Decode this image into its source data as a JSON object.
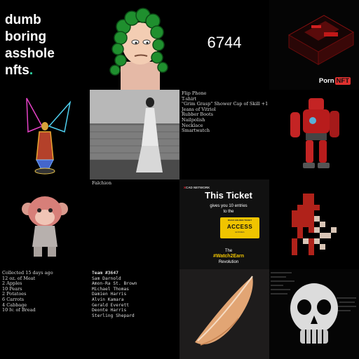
{
  "brand": {
    "line1": "dumb",
    "line2": "boring",
    "line3": "asshole",
    "line4": "nfts",
    "dot": "."
  },
  "big_number": "6744",
  "porn_tile": {
    "word": "Porn",
    "badge": "NFT",
    "accent": "#e0312f"
  },
  "inventory": [
    "Flip Phone",
    "T-shirt",
    "\"Grim Grasp\" Shower Cap of Skill +1",
    "Jeans of Vitriol",
    "Rubber Boots",
    "Nailpolish",
    "Necklace",
    "Smartwatch"
  ],
  "weapon": "Falchion",
  "ticket": {
    "network": "CAD NETWORK",
    "network_prefix": "X",
    "title": "This Ticket",
    "line1": "gives you 10 entries",
    "line2": "to the",
    "card_top": "ROAD GOLDEN TICKET",
    "card_main": "ACCESS",
    "card_bottom": "ENTRIES",
    "foot1": "The",
    "foot2": "#Watch2Earn",
    "foot3": "Revolution"
  },
  "loot": {
    "header": "Collected 15 days ago",
    "items": [
      "12 oz. of Meat",
      "2 Apples",
      "10 Pears",
      "2 Potatoes",
      "6 Carrots",
      "4 Cabbage",
      "10 lv. of Bread"
    ]
  },
  "team": {
    "header": "Team #3647",
    "players": [
      "Sam Darnold",
      "Amon-Ra St. Brown",
      "Michael Thomas",
      "Damien Harris",
      "Alvin Kamara",
      "Gerald Everett",
      "Deonte Harris",
      "Sterling Shepard"
    ]
  },
  "colors": {
    "accent_teal": "#2fd6a5",
    "ticket_yellow": "#f0c400"
  }
}
